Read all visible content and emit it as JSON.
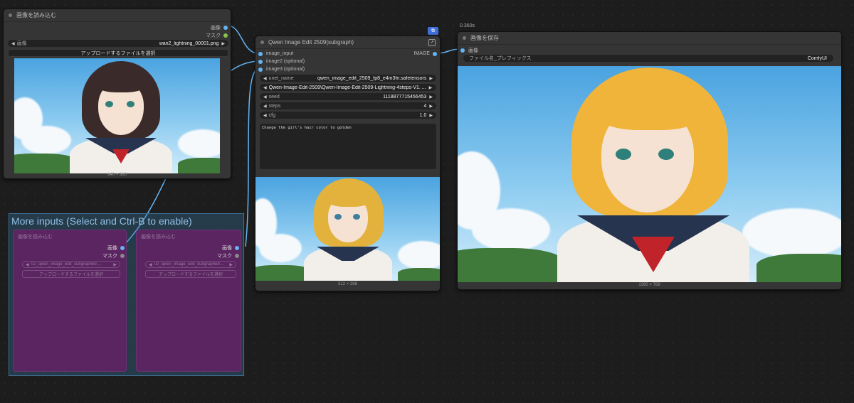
{
  "load_node": {
    "title": "画像を読み込む",
    "out_image": "画像",
    "out_mask": "マスク",
    "image_label": "画像",
    "image_value": "wan2_lightning_00001.png",
    "upload_label": "アップロードするファイルを選択",
    "dim": "640 × 360"
  },
  "qwen_node": {
    "title": "Qwen Image Edit 2509(subgraph)",
    "in1": "image_input",
    "in2": "image2 (optional)",
    "in3": "image3 (optional)",
    "out": "IMAGE",
    "widgets": [
      {
        "label": "unet_name",
        "value": "qwen_image_edit_2509_fp8_e4m3fn.safetensors"
      },
      {
        "label": "",
        "value": "Qwen-Image-Edit-2509\\Qwen-Image-Edit-2509-Lightning-4steps-V1. ..."
      },
      {
        "label": "seed",
        "value": "1118877715456453"
      },
      {
        "label": "steps",
        "value": "4"
      },
      {
        "label": "cfg",
        "value": "1.0"
      }
    ],
    "prompt": "Change the girl's hair color to golden",
    "dim": "512 × 288"
  },
  "save_node": {
    "timer": "0.360s",
    "title": "画像を保存",
    "in_image": "画像",
    "prefix_label": "ファイル名_プレフィックス",
    "prefix_value": "ComfyUI",
    "dim": "1360 × 768"
  },
  "group": {
    "title": "More inputs (Select and Ctrl-B to enable)",
    "nodes": [
      {
        "title": "画像を読み込む",
        "out_image": "画像",
        "out_mask": "マスク",
        "image_value": "02_qwen_image_edit_subgraphed ...",
        "upload_label": "アップロードするファイルを選択"
      },
      {
        "title": "画像を読み込む",
        "out_image": "画像",
        "out_mask": "マスク",
        "image_value": "02_qwen_image_edit_subgraphed ...",
        "upload_label": "アップロードするファイルを選択"
      }
    ]
  },
  "colors": {
    "link": "#64b5f6",
    "group_bg": "#3a75a0",
    "bypassed_node": "#5a2560",
    "node_bg": "#353535"
  },
  "icons": [
    "node-dot-icon",
    "subgraph-badge-icon",
    "enter-subgraph-icon",
    "arrow-left-icon",
    "arrow-right-icon"
  ]
}
